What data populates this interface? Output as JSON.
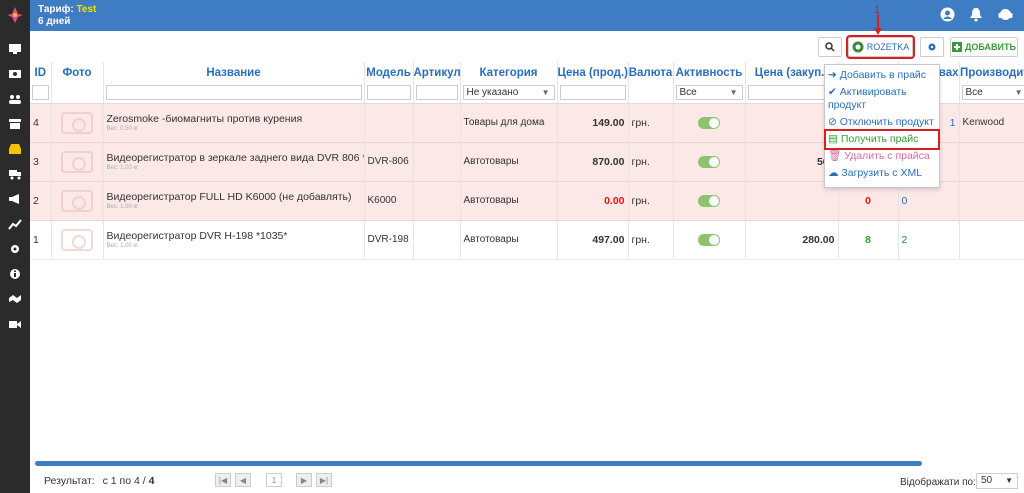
{
  "topbar": {
    "tariff_label": "Тариф:",
    "tariff_value": "Test",
    "days": "6 дней"
  },
  "toolbar": {
    "rozetka_label": "ROZETKA",
    "add_label": "ДОБАВИТЬ"
  },
  "columns": [
    "ID",
    "Фото",
    "Название",
    "Модель",
    "Артикул",
    "Категория",
    "Цена (прод.)",
    "Валюта",
    "Активность",
    "Цена (закуп.)",
    "",
    "вах",
    "Производит"
  ],
  "filters": {
    "category": "Не указано",
    "activity": "Все",
    "producer": "Все"
  },
  "rows": [
    {
      "id": "4",
      "name": "Zerosmoke -биомагниты против курения",
      "weight": "Вес: 0.50 кг",
      "model": "",
      "article": "",
      "category": "Товары для дома",
      "price": "149.00",
      "currency": "грн.",
      "purchase": "",
      "stock": "",
      "wax": "1",
      "producer": "Kenwood"
    },
    {
      "id": "3",
      "name": "Видеорегистратор в зеркале заднего вида DVR 806 *1037",
      "weight": "Вес: 1.00 кг",
      "model": "DVR-806",
      "article": "",
      "category": "Автотовары",
      "price": "870.00",
      "currency": "грн.",
      "purchase": "560",
      "stock": "",
      "wax": "0",
      "producer": ""
    },
    {
      "id": "2",
      "name": "Видеорегистратор FULL HD K6000 (не добавлять)",
      "weight": "Вес: 1.00 кг",
      "model": "K6000",
      "article": "",
      "category": "Автотовары",
      "price": "0.00",
      "currency": "грн.",
      "purchase": "",
      "stock": "0",
      "wax": "0",
      "producer": ""
    },
    {
      "id": "1",
      "name": "Видеорегистратор DVR H-198 *1035*",
      "weight": "Вес: 1.00 кг",
      "model": "DVR-198",
      "article": "",
      "category": "Автотовары",
      "price": "497.00",
      "currency": "грн.",
      "purchase": "280.00",
      "stock": "8",
      "wax": "2",
      "producer": ""
    }
  ],
  "dropdown": {
    "add_to_price": "Добавить в прайс",
    "activate_line1": "Активировать",
    "activate_line2": "продукт",
    "disable": "Отключить продукт",
    "get_price": "Получить прайс",
    "delete_from_price": "Удалить с прайса",
    "load_xml": "Загрузить с XML"
  },
  "annotations": {
    "one": "1",
    "two": "2"
  },
  "footer": {
    "result_label": "Результат:",
    "result_text": "с 1 по 4 /",
    "total": "4",
    "page": "1",
    "per_page_label": "Відображати по:",
    "per_page": "50"
  },
  "colors": {
    "primary": "#3e7cc3",
    "sidebar": "#2b2b2b",
    "highlight": "#d61f1f",
    "row_pink": "#fde8e8"
  }
}
